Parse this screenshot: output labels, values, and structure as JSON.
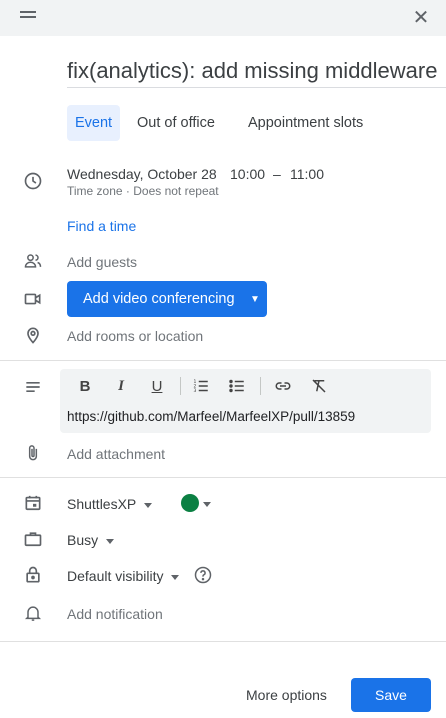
{
  "title": "fix(analytics): add missing middleware",
  "tabs": [
    "Event",
    "Out of office",
    "Appointment slots"
  ],
  "datetime": {
    "date": "Wednesday, October 28",
    "start": "10:00",
    "dash": "–",
    "end": "11:00",
    "meta": "Time zone · Does not repeat"
  },
  "find_time": "Find a time",
  "guests_placeholder": "Add guests",
  "video_button": "Add video conferencing",
  "location_placeholder": "Add rooms or location",
  "description": {
    "toolbar": {
      "bold": "B",
      "italic": "I",
      "underline": "U"
    },
    "text": "https://github.com/Marfeel/MarfeelXP/pull/13859"
  },
  "attachment": "Add attachment",
  "calendar": {
    "name": "ShuttlesXP",
    "color": "#0b8043"
  },
  "availability": "Busy",
  "visibility": "Default visibility",
  "notification": "Add notification",
  "footer": {
    "more_options": "More options",
    "save": "Save"
  },
  "colors": {
    "accent": "#1a73e8",
    "text": "#3c4043",
    "muted": "#70757a"
  }
}
